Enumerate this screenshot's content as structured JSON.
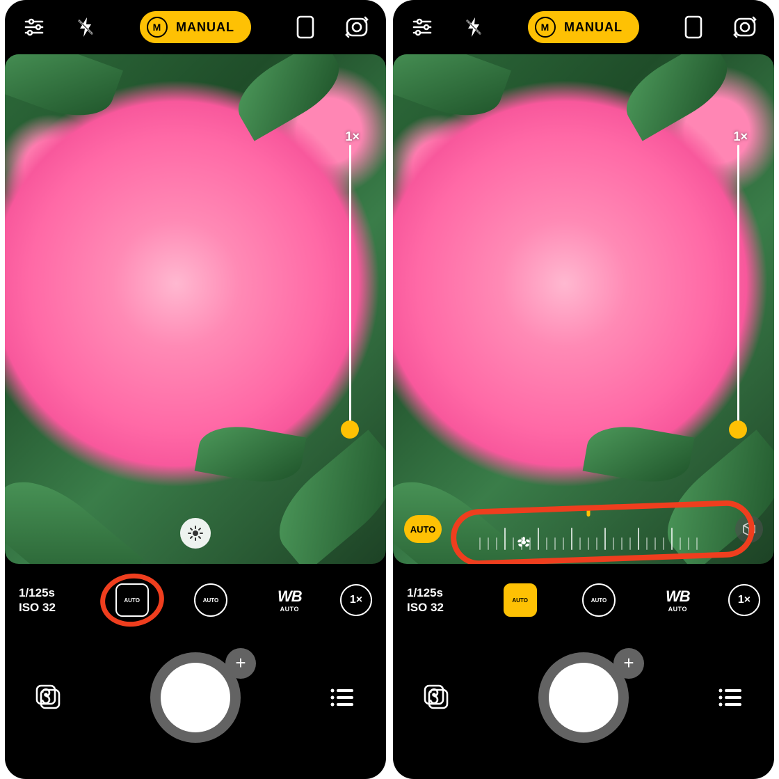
{
  "colors": {
    "accent": "#fec104",
    "highlight": "#ef3e1e"
  },
  "top": {
    "mode_letter": "M",
    "mode_label": "MANUAL"
  },
  "viewfinder": {
    "zoom_label": "1×"
  },
  "focus_overlay": {
    "auto_label": "AUTO"
  },
  "readout": {
    "shutter": "1/125s",
    "iso": "ISO 32"
  },
  "controls": {
    "focus_label": "AUTO",
    "aperture_label": "AUTO",
    "wb_label": "WB",
    "wb_sub": "AUTO",
    "lens_label": "1×"
  },
  "shutter": {
    "plus": "+"
  }
}
